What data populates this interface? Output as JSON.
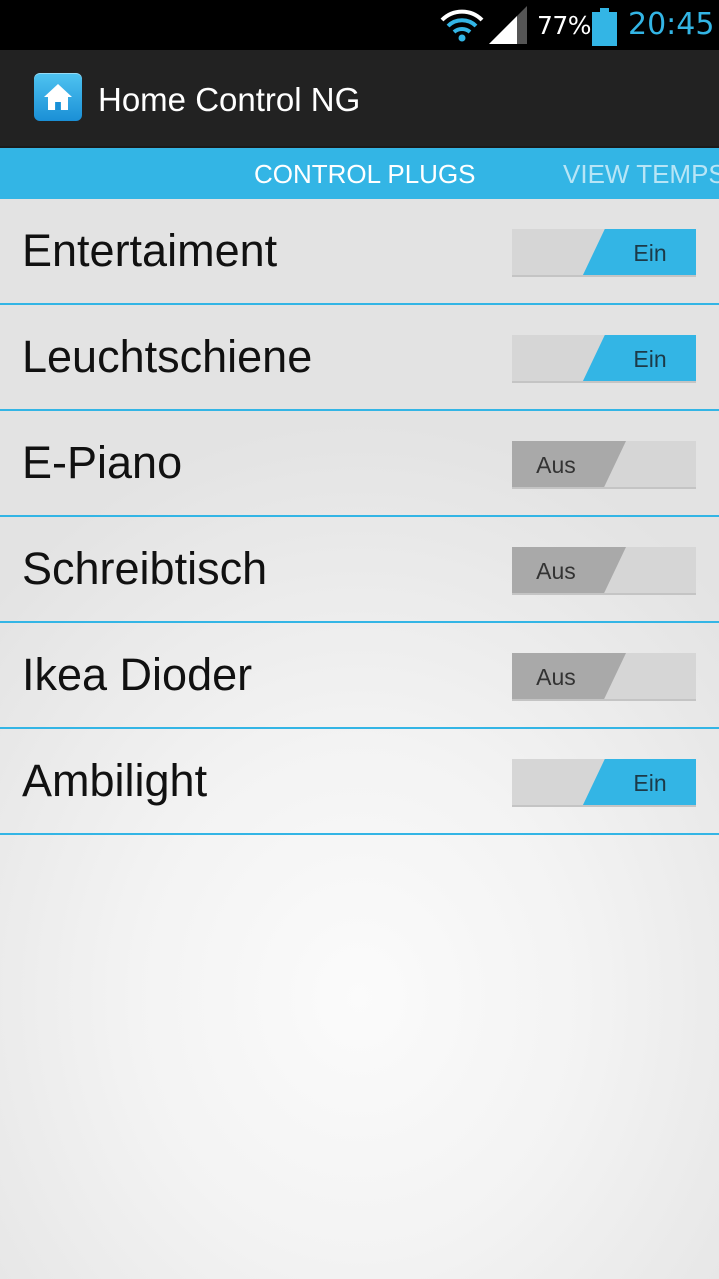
{
  "status_bar": {
    "battery_percent": "77%",
    "time": "20:45",
    "icons": [
      "wifi-icon",
      "signal-icon",
      "battery-icon"
    ]
  },
  "app": {
    "title": "Home Control NG",
    "icon": "home-icon"
  },
  "tabs": [
    {
      "label": "CONTROL PLUGS",
      "active": true
    },
    {
      "label": "VIEW TEMPS",
      "active": false
    }
  ],
  "plugs": [
    {
      "name": "Entertaiment",
      "state_label": "Ein",
      "on": true
    },
    {
      "name": "Leuchtschiene",
      "state_label": "Ein",
      "on": true
    },
    {
      "name": "E-Piano",
      "state_label": "Aus",
      "on": false
    },
    {
      "name": "Schreibtisch",
      "state_label": "Aus",
      "on": false
    },
    {
      "name": "Ikea Dioder",
      "state_label": "Aus",
      "on": false
    },
    {
      "name": "Ambilight",
      "state_label": "Ein",
      "on": true
    }
  ],
  "colors": {
    "accent": "#33b5e5",
    "action_bar": "#222222",
    "status_bar": "#000000"
  }
}
